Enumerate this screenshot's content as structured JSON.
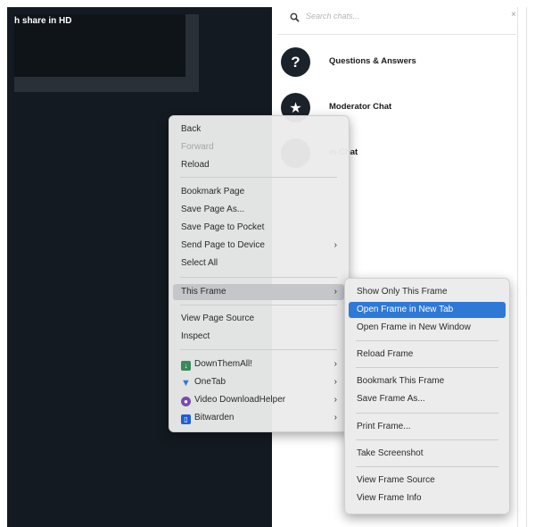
{
  "video": {
    "title": "h share in HD"
  },
  "chat_panel": {
    "search_placeholder": "Search chats...",
    "search_clear": "×",
    "items": [
      {
        "label": "Questions & Answers",
        "avatar_glyph": "?"
      },
      {
        "label": "Moderator Chat",
        "avatar_glyph": "★"
      },
      {
        "label": "m Chat",
        "avatar_glyph": ""
      }
    ]
  },
  "context_menu": {
    "items": [
      {
        "label": "Back"
      },
      {
        "label": "Forward",
        "disabled": true
      },
      {
        "label": "Reload"
      },
      {
        "label": "Bookmark Page"
      },
      {
        "label": "Save Page As..."
      },
      {
        "label": "Save Page to Pocket"
      },
      {
        "label": "Send Page to Device",
        "submenu_arrow": "›"
      },
      {
        "label": "Select All"
      },
      {
        "label": "This Frame",
        "submenu_arrow": "›",
        "highlighted": true
      },
      {
        "label": "View Page Source"
      },
      {
        "label": "Inspect"
      },
      {
        "label": "DownThemAll!",
        "submenu_arrow": "›",
        "icon": "downthemall-icon"
      },
      {
        "label": "OneTab",
        "submenu_arrow": "›",
        "icon": "onetab-icon"
      },
      {
        "label": "Video DownloadHelper",
        "submenu_arrow": "›",
        "icon": "video-downloadhelper-icon"
      },
      {
        "label": "Bitwarden",
        "submenu_arrow": "›",
        "icon": "bitwarden-icon"
      }
    ]
  },
  "frame_submenu": {
    "items": [
      {
        "label": "Show Only This Frame"
      },
      {
        "label": "Open Frame in New Tab",
        "selected": true
      },
      {
        "label": "Open Frame in New Window"
      },
      {
        "label": "Reload Frame"
      },
      {
        "label": "Bookmark This Frame"
      },
      {
        "label": "Save Frame As..."
      },
      {
        "label": "Print Frame..."
      },
      {
        "label": "Take Screenshot"
      },
      {
        "label": "View Frame Source"
      },
      {
        "label": "View Frame Info"
      }
    ]
  },
  "colors": {
    "video_bg": "#141a21",
    "selection": "#2f79d6",
    "hover": "#c4c6c9"
  }
}
